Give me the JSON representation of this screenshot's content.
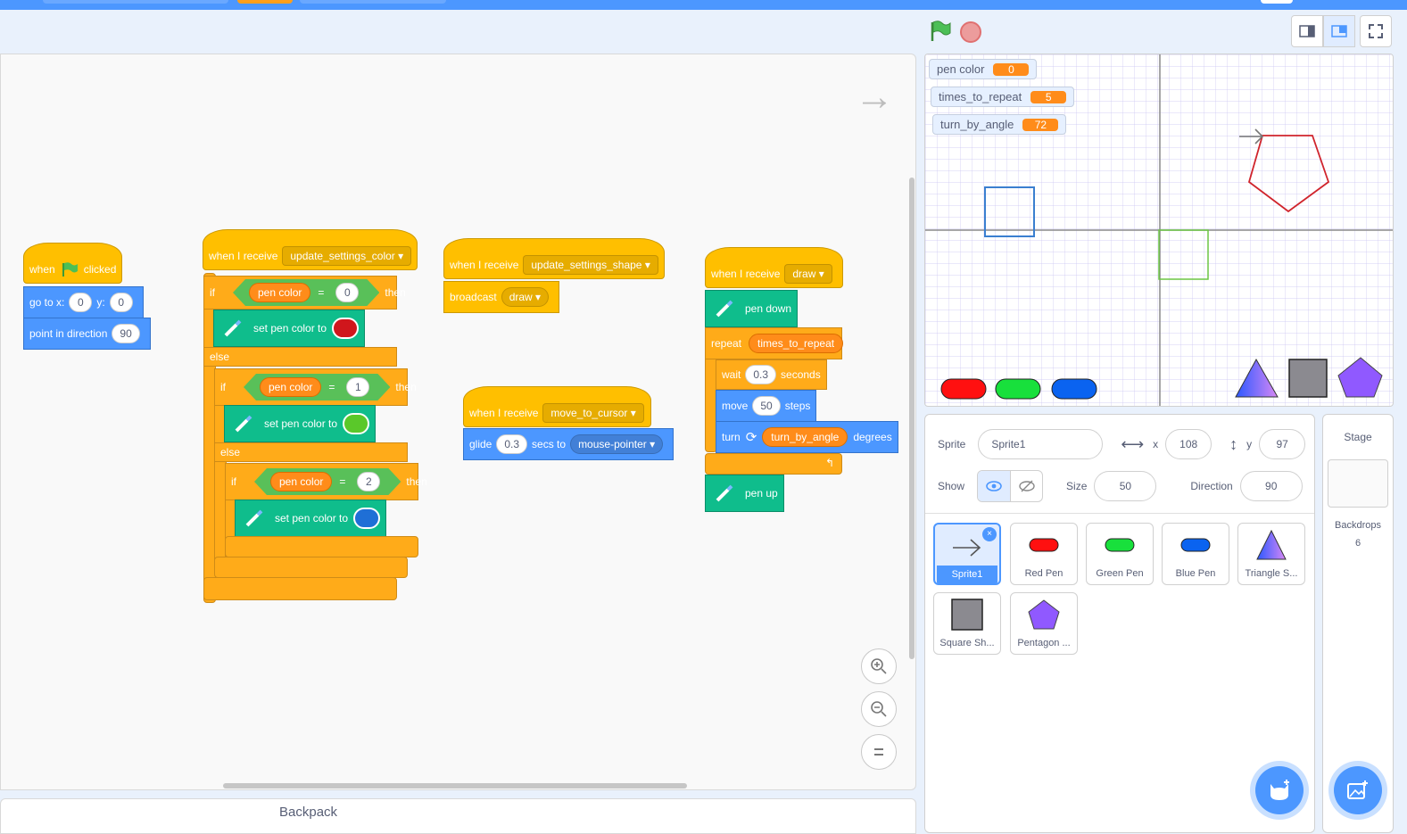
{
  "colors": {
    "accent": "#4c97ff",
    "events": "#ffbf00",
    "motion": "#4c97ff",
    "control": "#ffab19",
    "pen": "#0fbd8c",
    "operators": "#59c059",
    "variables": "#ff8c1a"
  },
  "code": {
    "flag_script": {
      "when": "when",
      "clicked": "clicked",
      "goto_label": "go to x:",
      "goto_x": "0",
      "goto_y_label": "y:",
      "goto_y": "0",
      "point_label": "point in direction",
      "point_val": "90"
    },
    "color_script": {
      "hat_label": "when I receive",
      "hat_msg": "update_settings_color",
      "if": "if",
      "then": "then",
      "else": "else",
      "eq": "=",
      "var": "pen color",
      "cond_vals": [
        "0",
        "1",
        "2"
      ],
      "set_label": "set pen color to",
      "swatches": [
        "#d0161c",
        "#5ac82a",
        "#1f6fd6"
      ]
    },
    "shape_script": {
      "hat_label": "when I receive",
      "hat_msg": "update_settings_shape",
      "broadcast": "broadcast",
      "broadcast_msg": "draw"
    },
    "cursor_script": {
      "hat_label": "when I receive",
      "hat_msg": "move_to_cursor",
      "glide": "glide",
      "glide_secs": "0.3",
      "secs_to": "secs to",
      "target": "mouse-pointer"
    },
    "draw_script": {
      "hat_label": "when I receive",
      "hat_msg": "draw",
      "pen_down": "pen down",
      "repeat": "repeat",
      "repeat_var": "times_to_repeat",
      "wait": "wait",
      "wait_val": "0.3",
      "seconds": "seconds",
      "move": "move",
      "move_val": "50",
      "steps": "steps",
      "turn": "turn",
      "turn_var": "turn_by_angle",
      "degrees": "degrees",
      "pen_up": "pen up"
    }
  },
  "backpack_label": "Backpack",
  "monitors": [
    {
      "name": "pen color",
      "value": "0"
    },
    {
      "name": "times_to_repeat",
      "value": "5"
    },
    {
      "name": "turn_by_angle",
      "value": "72"
    }
  ],
  "sprite_info": {
    "sprite_label": "Sprite",
    "sprite_name": "Sprite1",
    "x_label": "x",
    "x": "108",
    "y_label": "y",
    "y": "97",
    "show_label": "Show",
    "size_label": "Size",
    "size": "50",
    "direction_label": "Direction",
    "direction": "90"
  },
  "sprites": [
    "Sprite1",
    "Red Pen",
    "Green Pen",
    "Blue Pen",
    "Triangle S...",
    "Square Sh...",
    "Pentagon ..."
  ],
  "stage_panel": {
    "title": "Stage",
    "backdrops_label": "Backdrops",
    "backdrops_count": "6"
  }
}
